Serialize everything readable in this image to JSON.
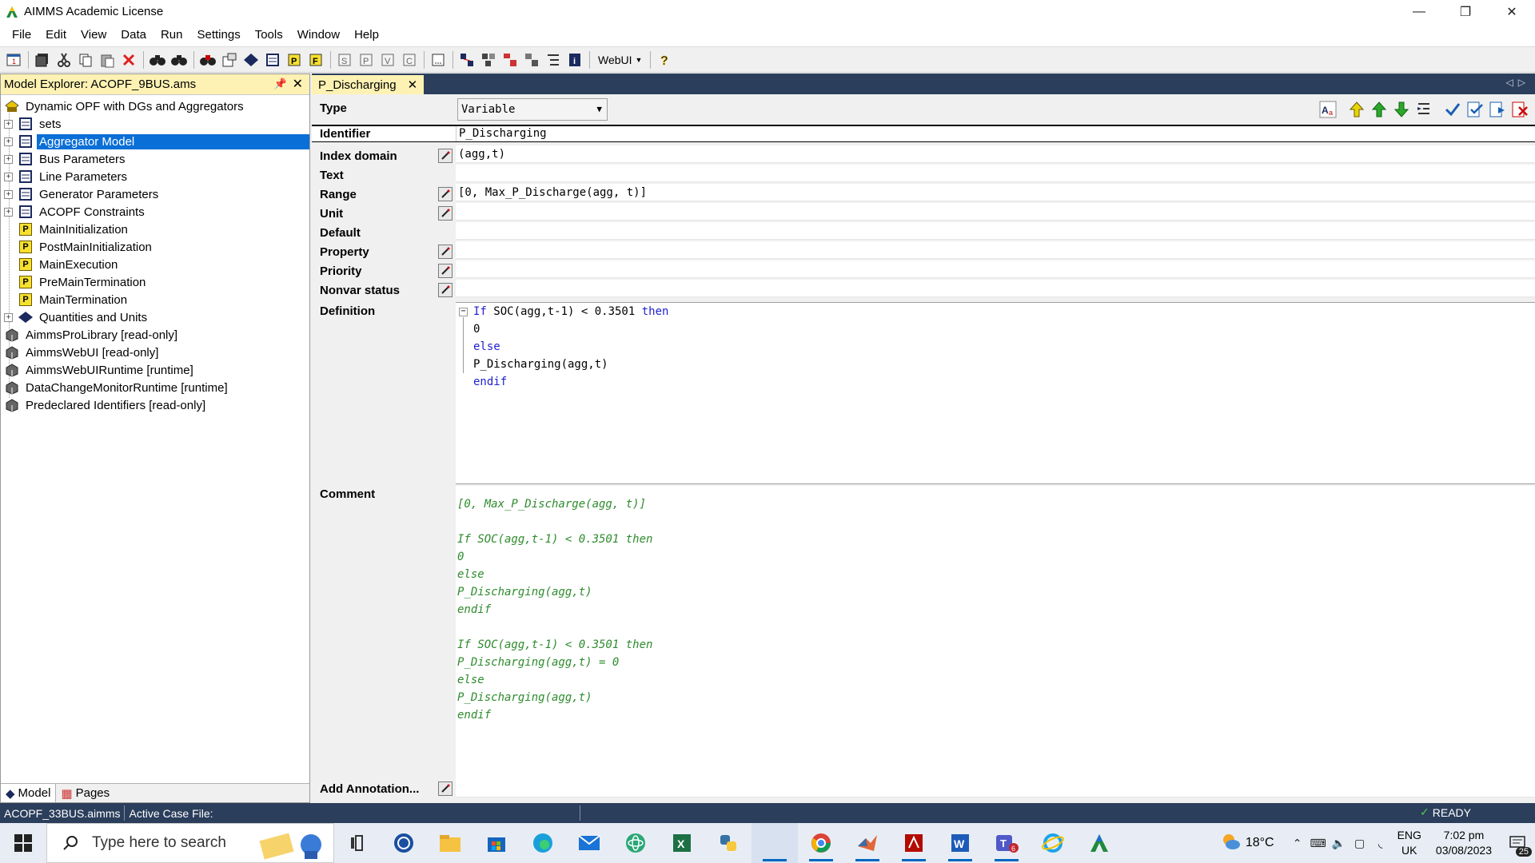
{
  "window": {
    "title": "AIMMS Academic License",
    "controls": [
      "—",
      "❐",
      "✕"
    ]
  },
  "menu": [
    "File",
    "Edit",
    "View",
    "Data",
    "Run",
    "Settings",
    "Tools",
    "Window",
    "Help"
  ],
  "toolbar": {
    "webui_label": "WebUI"
  },
  "explorer": {
    "title": "Model Explorer: ACOPF_9BUS.ams",
    "root": "Dynamic OPF with DGs and Aggregators",
    "items": [
      {
        "label": "sets",
        "kind": "section",
        "expandable": true
      },
      {
        "label": "Aggregator Model",
        "kind": "section",
        "expandable": true,
        "selected": true
      },
      {
        "label": "Bus Parameters",
        "kind": "section",
        "expandable": true
      },
      {
        "label": "Line Parameters",
        "kind": "section",
        "expandable": true
      },
      {
        "label": "Generator Parameters",
        "kind": "section",
        "expandable": true
      },
      {
        "label": "ACOPF Constraints",
        "kind": "section",
        "expandable": true
      },
      {
        "label": "MainInitialization",
        "kind": "procedure"
      },
      {
        "label": "PostMainInitialization",
        "kind": "procedure"
      },
      {
        "label": "MainExecution",
        "kind": "procedure"
      },
      {
        "label": "PreMainTermination",
        "kind": "procedure"
      },
      {
        "label": "MainTermination",
        "kind": "procedure"
      },
      {
        "label": "Quantities and Units",
        "kind": "declaration",
        "expandable": true
      }
    ],
    "libraries": [
      "AimmsProLibrary [read-only]",
      "AimmsWebUI [read-only]",
      "AimmsWebUIRuntime [runtime]",
      "DataChangeMonitorRuntime [runtime]",
      "Predeclared Identifiers [read-only]"
    ],
    "tabs": [
      "Model",
      "Pages"
    ]
  },
  "editor": {
    "tab_title": "P_Discharging",
    "type_label": "Type",
    "type_value": "Variable",
    "attributes": [
      {
        "label": "Identifier",
        "value": "P_Discharging",
        "wizard": false
      },
      {
        "label": "Index domain",
        "value": "(agg,t)",
        "wizard": true
      },
      {
        "label": "Text",
        "value": "",
        "wizard": false
      },
      {
        "label": "Range",
        "value": "[0, Max_P_Discharge(agg, t)]",
        "wizard": true
      },
      {
        "label": "Unit",
        "value": "",
        "wizard": true
      },
      {
        "label": "Default",
        "value": "",
        "wizard": false
      },
      {
        "label": "Property",
        "value": "",
        "wizard": true
      },
      {
        "label": "Priority",
        "value": "",
        "wizard": true
      },
      {
        "label": "Nonvar status",
        "value": "",
        "wizard": true
      }
    ],
    "definition_label": "Definition",
    "definition_lines": [
      {
        "kw1": "If",
        "text": " SOC(agg,t-1) < 0.3501 ",
        "kw2": "then"
      },
      {
        "text": "0"
      },
      {
        "kw1": "else",
        "text": ""
      },
      {
        "text": "P_Discharging(agg,t)"
      },
      {
        "kw1": "endif",
        "text": ""
      }
    ],
    "comment_label": "Comment",
    "comment_lines": [
      "[0, Max_P_Discharge(agg, t)]",
      "",
      "If SOC(agg,t-1) < 0.3501 then",
      "0",
      "else",
      "P_Discharging(agg,t)",
      "endif",
      "",
      "If SOC(agg,t-1) < 0.3501 then",
      "P_Discharging(agg,t) = 0",
      "else",
      "P_Discharging(agg,t)",
      "endif"
    ],
    "annotation_label": "Add Annotation..."
  },
  "status": {
    "project": "ACOPF_33BUS.aimms",
    "case_file": "Active Case File:",
    "ready": "READY"
  },
  "taskbar": {
    "search_placeholder": "Type here to search",
    "temperature": "18°C",
    "lang_1": "ENG",
    "lang_2": "UK",
    "time": "7:02 pm",
    "date": "03/08/2023",
    "notifications": "25"
  }
}
